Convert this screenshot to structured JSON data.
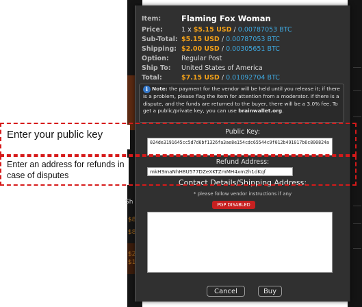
{
  "item": {
    "labels": {
      "item": "Item:",
      "price": "Price:",
      "subtotal": "Sub-Total:",
      "shipping": "Shipping:",
      "option": "Option:",
      "ship_to": "Ship To:",
      "total": "Total:"
    },
    "title": "Flaming Fox Woman",
    "price_qty": "1 x ",
    "price_usd": "$5.15 USD",
    "price_btc": "0.00787053 BTC",
    "subtotal_usd": "$5.15 USD",
    "subtotal_btc": "0.00787053 BTC",
    "shipping_usd": "$2.00 USD",
    "shipping_btc": "0.00305651 BTC",
    "option": "Regular Post",
    "ship_to": "United States of America",
    "total_usd": "$7.15 USD",
    "total_btc": "0.01092704 BTC",
    "separator": " / "
  },
  "note": {
    "icon": "info-icon",
    "icon_glyph": "i",
    "prefix": "Note:",
    "text": " the payment for the vendor will be held until you release it; if there is a problem, please flag the item for attention from a moderator. If there is a dispute, and the funds are returned to the buyer, there will be a 3.0% fee. To get a public/private key, you can use ",
    "link": "brainwallet.org",
    "suffix": "."
  },
  "public_key": {
    "label": "Public Key:",
    "value": "024de3191645cc5d7d6bf1326fa3ae8e154cdc65544c9f012b491017b6c800824a"
  },
  "refund": {
    "label": "Refund Address:",
    "value": "mkH3maNhH8U577DZeXKTZmMH4xm2h1dKqf"
  },
  "contact": {
    "label": "Contact Details/Shipping Address:",
    "hint": "* please follow vendor instructions if any",
    "pgp_label": "PGP DISABLED",
    "message": ""
  },
  "buttons": {
    "cancel": "Cancel",
    "buy": "Buy"
  },
  "annotations": {
    "public_key_callout": "Enter your public key",
    "refund_callout": "Enter an address for refunds in case of disputes"
  },
  "background": {
    "price_fragments": [
      "$8",
      "$8",
      "$2",
      "$1"
    ],
    "tab_fragment": "Sh"
  },
  "colors": {
    "usd": "#f2a11a",
    "btc": "#3fa9e0",
    "pgp_bg": "#c62020",
    "dashed_outline": "#d61a1a",
    "modal_bg": "#303030",
    "info_icon": "#3477c8"
  }
}
